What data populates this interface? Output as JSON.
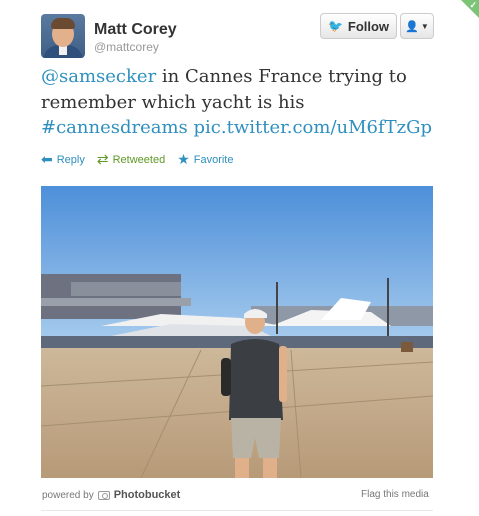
{
  "author": {
    "name": "Matt Corey",
    "handle": "@mattcorey"
  },
  "buttons": {
    "follow_label": "Follow",
    "user_menu_icon": "user-dropdown-icon"
  },
  "tweet": {
    "mention": "@samsecker",
    "text_part1": " in Cannes France trying to remember which yacht is his",
    "hashtag": "#cannesdreams",
    "media_link": "pic.twitter.com/uM6fTzGp"
  },
  "actions": {
    "reply": "Reply",
    "retweeted": "Retweeted",
    "favorite": "Favorite"
  },
  "media": {
    "powered_by": "powered by",
    "provider": "Photobucket",
    "flag_label": "Flag this media"
  },
  "colors": {
    "link": "#2f8fbf",
    "retweeted": "#609928",
    "corner_badge": "#7cc576"
  }
}
